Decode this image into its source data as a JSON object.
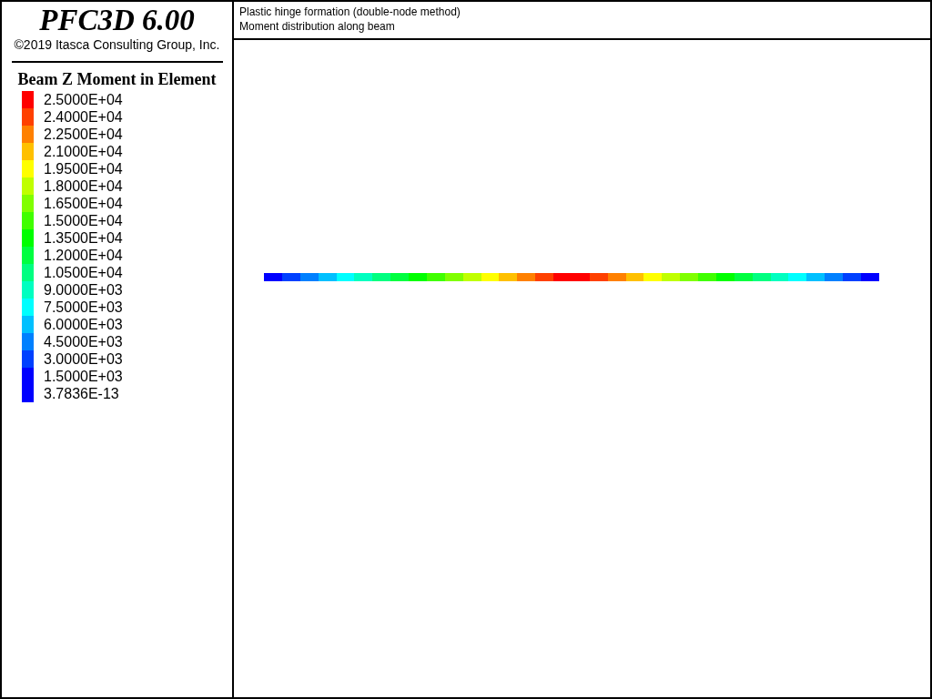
{
  "sidebar": {
    "product_title": "PFC3D 6.00",
    "copyright": "©2019 Itasca Consulting Group, Inc.",
    "legend": {
      "title": "Beam Z Moment in Element",
      "items": [
        {
          "label": "2.5000E+04",
          "color": "#ff0000"
        },
        {
          "label": "2.4000E+04",
          "color": "#ff4000"
        },
        {
          "label": "2.2500E+04",
          "color": "#ff8000"
        },
        {
          "label": "2.1000E+04",
          "color": "#ffc000"
        },
        {
          "label": "1.9500E+04",
          "color": "#ffff00"
        },
        {
          "label": "1.8000E+04",
          "color": "#c0ff00"
        },
        {
          "label": "1.6500E+04",
          "color": "#80ff00"
        },
        {
          "label": "1.5000E+04",
          "color": "#40ff00"
        },
        {
          "label": "1.3500E+04",
          "color": "#00ff00"
        },
        {
          "label": "1.2000E+04",
          "color": "#00ff40"
        },
        {
          "label": "1.0500E+04",
          "color": "#00ff80"
        },
        {
          "label": "9.0000E+03",
          "color": "#00ffc0"
        },
        {
          "label": "7.5000E+03",
          "color": "#00ffff"
        },
        {
          "label": "6.0000E+03",
          "color": "#00c0ff"
        },
        {
          "label": "4.5000E+03",
          "color": "#0080ff"
        },
        {
          "label": "3.0000E+03",
          "color": "#0040ff"
        },
        {
          "label": "1.5000E+03",
          "color": "#0000ff"
        },
        {
          "label": "3.7836E-13",
          "color": "#0000ff"
        }
      ]
    }
  },
  "header": {
    "title": "Plastic hinge formation (double-node method)",
    "subtitle": "Moment distribution along beam"
  },
  "beam": {
    "segments": [
      {
        "color": "#0000ff"
      },
      {
        "color": "#0040ff"
      },
      {
        "color": "#0080ff"
      },
      {
        "color": "#00c0ff"
      },
      {
        "color": "#00ffff"
      },
      {
        "color": "#00ffc0"
      },
      {
        "color": "#00ff80"
      },
      {
        "color": "#00ff40"
      },
      {
        "color": "#00ff00"
      },
      {
        "color": "#40ff00"
      },
      {
        "color": "#80ff00"
      },
      {
        "color": "#c0ff00"
      },
      {
        "color": "#ffff00"
      },
      {
        "color": "#ffc000"
      },
      {
        "color": "#ff8000"
      },
      {
        "color": "#ff4000"
      },
      {
        "color": "#ff0000"
      },
      {
        "color": "#ff0000"
      },
      {
        "color": "#ff4000"
      },
      {
        "color": "#ff8000"
      },
      {
        "color": "#ffc000"
      },
      {
        "color": "#ffff00"
      },
      {
        "color": "#c0ff00"
      },
      {
        "color": "#80ff00"
      },
      {
        "color": "#40ff00"
      },
      {
        "color": "#00ff00"
      },
      {
        "color": "#00ff40"
      },
      {
        "color": "#00ff80"
      },
      {
        "color": "#00ffc0"
      },
      {
        "color": "#00ffff"
      },
      {
        "color": "#00c0ff"
      },
      {
        "color": "#0080ff"
      },
      {
        "color": "#0040ff"
      },
      {
        "color": "#0000ff"
      }
    ]
  }
}
